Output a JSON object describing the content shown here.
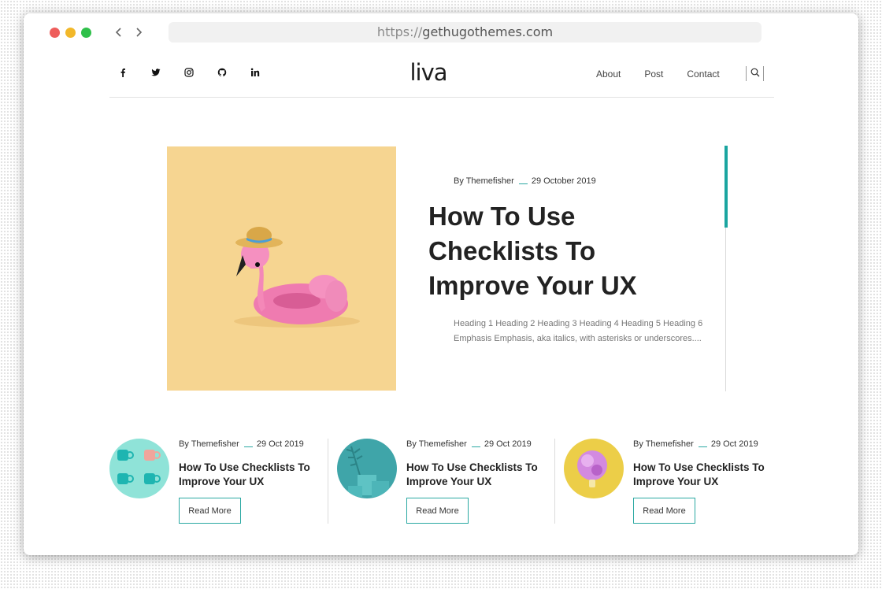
{
  "browser": {
    "url_protocol": "https://",
    "url_host": "gethugothemes.com"
  },
  "site": {
    "logo": "liva",
    "social_icons": [
      "facebook-icon",
      "twitter-icon",
      "instagram-icon",
      "github-icon",
      "linkedin-icon"
    ],
    "menu": [
      "About",
      "Post",
      "Contact"
    ]
  },
  "featured": {
    "author": "By Themefisher",
    "date": "29 October 2019",
    "title": "How To Use Checklists To Improve Your UX",
    "excerpt": "Heading 1 Heading 2 Heading 3 Heading 4 Heading 5 Heading 6 Emphasis Emphasis, aka italics, with asterisks or underscores...."
  },
  "cards": [
    {
      "author": "By Themefisher",
      "date": "29 Oct 2019",
      "title": "How To Use Checklists To Improve Your UX",
      "button": "Read More"
    },
    {
      "author": "By Themefisher",
      "date": "29 Oct 2019",
      "title": "How To Use Checklists To Improve Your UX",
      "button": "Read More"
    },
    {
      "author": "By Themefisher",
      "date": "29 Oct 2019",
      "title": "How To Use Checklists To Improve Your UX",
      "button": "Read More"
    }
  ],
  "colors": {
    "accent": "#1aa5a0",
    "featured_bg": "#f6d591"
  }
}
